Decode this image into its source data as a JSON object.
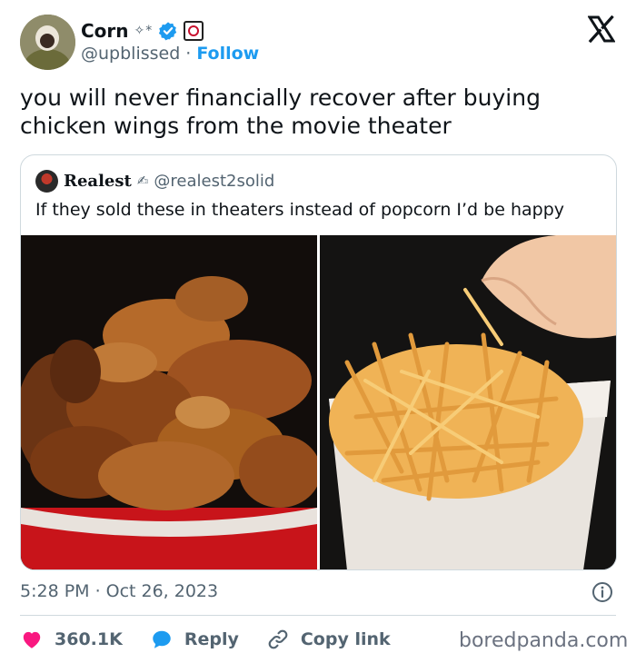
{
  "author": {
    "name": "Corn",
    "name_decoration": "✧*",
    "handle": "@upblissed",
    "follow_label": "Follow",
    "separator": "·",
    "verified_color": "#1d9bf0"
  },
  "tweet": {
    "text": "you will never financially recover after buying chicken wings from the movie theater",
    "time": "5:28 PM",
    "date_separator": "·",
    "date": "Oct 26, 2023"
  },
  "quoted": {
    "name": "Realest",
    "name_decoration": "✍",
    "handle": "@realest2solid",
    "text": "If they sold these in theaters instead of popcorn I’d be happy",
    "images": [
      "chicken-wings-bucket",
      "fries-in-popcorn-bucket"
    ]
  },
  "actions": {
    "likes": "360.1K",
    "reply_label": "Reply",
    "copy_label": "Copy link",
    "like_color": "#f91880",
    "reply_color": "#1d9bf0"
  },
  "watermark": "boredpanda.com",
  "icons": {
    "logo": "x-logo-icon",
    "info": "info-icon",
    "like": "heart-icon",
    "reply": "reply-bubble-icon",
    "copy": "link-icon"
  }
}
